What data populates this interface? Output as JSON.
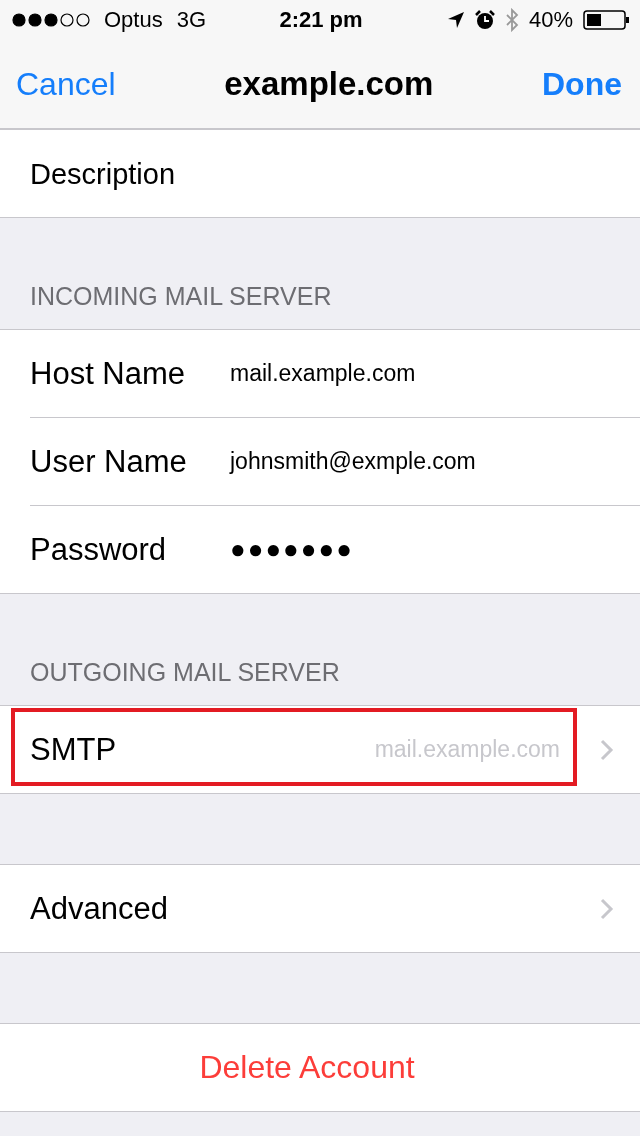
{
  "status_bar": {
    "carrier": "Optus",
    "network": "3G",
    "time": "2:21 pm",
    "battery": "40%"
  },
  "nav": {
    "cancel": "Cancel",
    "title": "example.com",
    "done": "Done"
  },
  "sections": [
    {
      "rows": [
        {
          "kind": "short",
          "label": "Description",
          "highlighted": false
        }
      ]
    },
    {
      "header": "INCOMING MAIL SERVER",
      "rows": [
        {
          "kind": "field",
          "label": "Host Name",
          "value": "mail.example.com",
          "highlighted": false
        },
        {
          "kind": "field",
          "label": "User Name",
          "value": "johnsmith@exmple.com",
          "highlighted": false
        },
        {
          "kind": "field",
          "label": "Password",
          "value": "●●●●●●●",
          "highlighted": false
        }
      ]
    },
    {
      "header": "OUTGOING MAIL SERVER",
      "rows": [
        {
          "kind": "link",
          "label": "SMTP",
          "value": "mail.example.com",
          "highlighted": true
        }
      ]
    },
    {
      "rows": [
        {
          "kind": "link",
          "label": "Advanced",
          "highlighted": false
        }
      ]
    },
    {
      "rows": [
        {
          "kind": "destructive",
          "label": "Delete Account",
          "highlighted": false
        }
      ]
    }
  ]
}
